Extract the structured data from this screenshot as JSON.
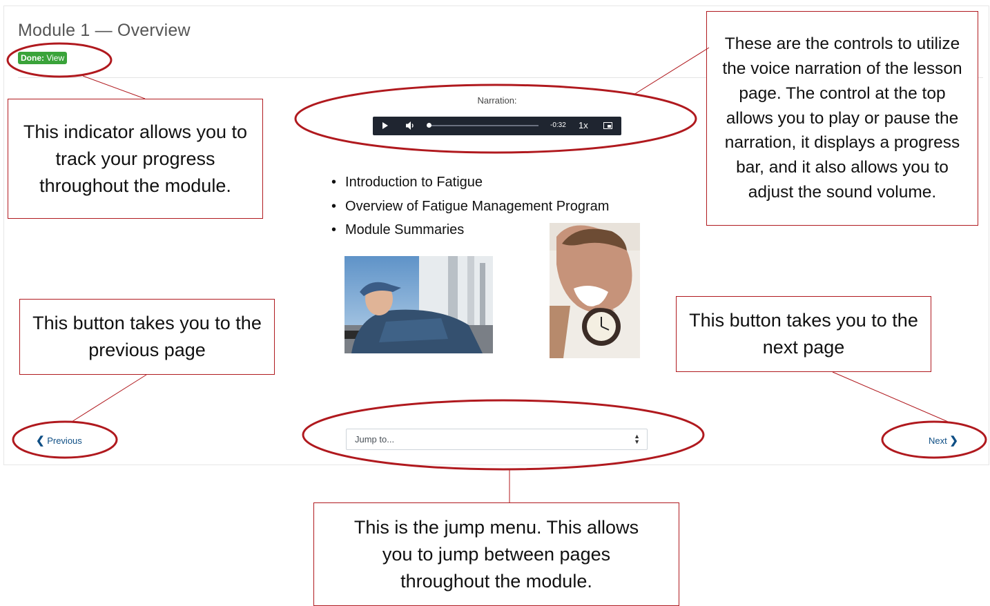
{
  "page": {
    "title": "Module 1 — Overview",
    "badge_strong": "Done:",
    "badge_text": " View"
  },
  "narration": {
    "label": "Narration:",
    "time": "-0:32",
    "speed": "1x",
    "progress": 0.0
  },
  "lesson": {
    "bullets": [
      "Introduction to Fatigue",
      "Overview of Fatigue Management Program",
      "Module Summaries"
    ]
  },
  "navigation": {
    "previous_label": "Previous",
    "next_label": "Next",
    "jump_placeholder": "Jump to..."
  },
  "callouts": {
    "progress": "This indicator allows you to track your progress throughout the module.",
    "narration": "These are the controls to utilize the voice narration of the lesson page. The control at the top allows you to play or pause the narration, it displays a progress bar, and it also allows you to adjust the sound volume.",
    "previous": "This button takes you to the previous page",
    "next": "This button takes you to the next page",
    "jump": "This is the jump menu. This allows you to jump between pages throughout the module."
  },
  "colors": {
    "annotation": "#b0191e",
    "badge": "#3aa33a",
    "player": "#1f2530",
    "link": "#0f4f85"
  }
}
